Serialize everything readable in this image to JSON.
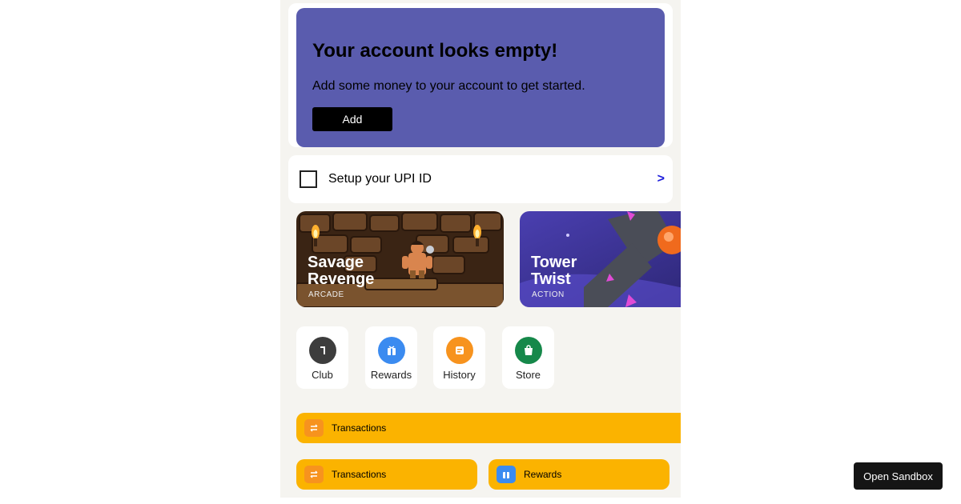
{
  "empty_state": {
    "title": "Your account looks empty!",
    "subtitle": "Add some money to your account to get started.",
    "add_label": "Add"
  },
  "upi": {
    "label": "Setup your UPI ID",
    "arrow": ">"
  },
  "games": [
    {
      "title_line1": "Savage",
      "title_line2": "Revenge",
      "genre": "ARCADE"
    },
    {
      "title_line1": "Tower",
      "title_line2": "Twist",
      "genre": "ACTION"
    }
  ],
  "quick_links": [
    {
      "label": "Club",
      "icon": "club-icon",
      "color": "#3d3d3d"
    },
    {
      "label": "Rewards",
      "icon": "rewards-icon",
      "color": "#3b8bf0"
    },
    {
      "label": "History",
      "icon": "history-icon",
      "color": "#f7931e"
    },
    {
      "label": "Store",
      "icon": "store-icon",
      "color": "#16884a"
    }
  ],
  "bars": {
    "full": {
      "label": "Transactions",
      "icon": "transactions-icon"
    },
    "half_left": {
      "label": "Transactions",
      "icon": "transactions-icon"
    },
    "half_right": {
      "label": "Rewards",
      "icon": "rewards-icon"
    }
  },
  "sandbox_label": "Open Sandbox",
  "colors": {
    "card_purple": "#5a5cae",
    "accent_yellow": "#fbb300",
    "icon_orange": "#f7931e",
    "icon_blue": "#3b8bf0",
    "icon_green": "#16884a",
    "arrow_blue": "#1a1adb"
  }
}
